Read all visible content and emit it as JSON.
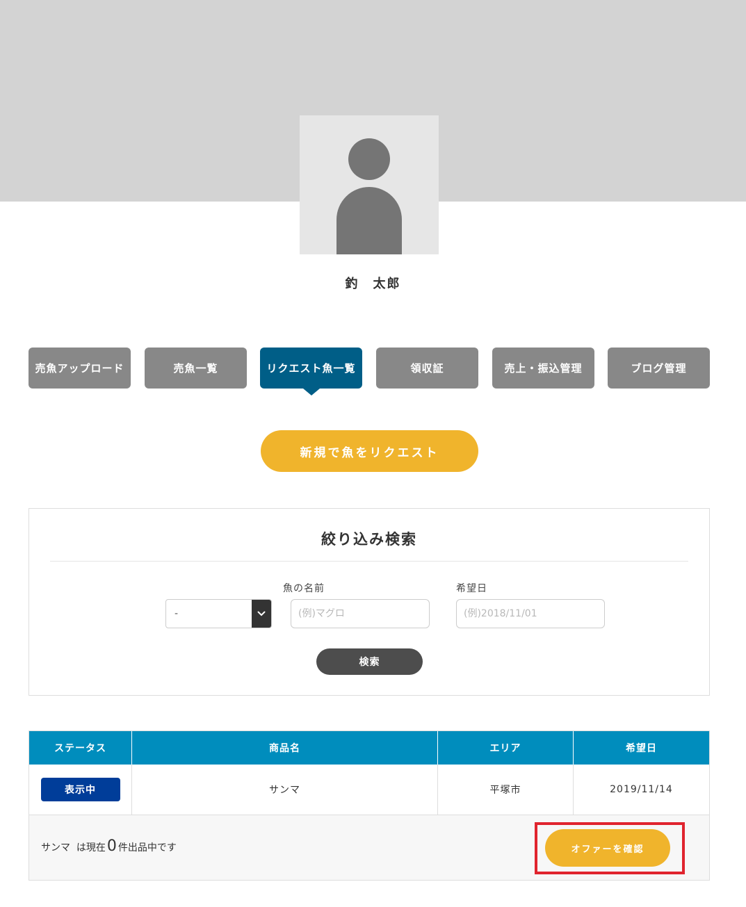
{
  "profile": {
    "name": "釣　太郎"
  },
  "tabs": [
    {
      "label": "売魚アップロード",
      "active": false
    },
    {
      "label": "売魚一覧",
      "active": false
    },
    {
      "label": "リクエスト魚一覧",
      "active": true
    },
    {
      "label": "領収証",
      "active": false
    },
    {
      "label": "売上・振込管理",
      "active": false
    },
    {
      "label": "ブログ管理",
      "active": false
    }
  ],
  "request_button": {
    "label": "新規で魚をリクエスト"
  },
  "filter": {
    "title": "絞り込み検索",
    "select": {
      "selected": "-"
    },
    "fish_name": {
      "label": "魚の名前",
      "placeholder": "(例)マグロ",
      "value": ""
    },
    "desired_date": {
      "label": "希望日",
      "placeholder": "(例)2018/11/01",
      "value": ""
    },
    "search_label": "検索"
  },
  "table": {
    "columns": [
      "ステータス",
      "商品名",
      "エリア",
      "希望日"
    ],
    "rows": [
      {
        "status": "表示中",
        "product": "サンマ",
        "area": "平塚市",
        "date": "2019/11/14"
      }
    ],
    "footer": {
      "fish": "サンマ",
      "text_before": "は現在",
      "count": "0",
      "text_after": "件出品中です",
      "offer_label": "オファーを確認"
    }
  },
  "colors": {
    "active_tab": "#005e87",
    "inactive_tab": "#888888",
    "accent_yellow": "#f0b42c",
    "table_header": "#008dbd",
    "status_badge": "#003d99",
    "highlight_border": "#e0242e"
  }
}
